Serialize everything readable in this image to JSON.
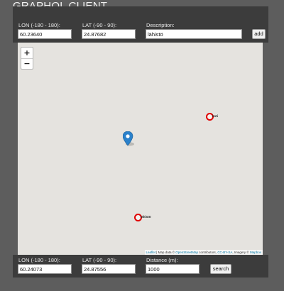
{
  "app": {
    "title": "GRAPHQL CLIENT"
  },
  "top_form": {
    "lon_label": "LON (-180 - 180):",
    "lon_value": "60.23640",
    "lat_label": "LAT (-90 - 90):",
    "lat_value": "24.87682",
    "description_label": "Description:",
    "description_value": "lähistö",
    "add_label": "add"
  },
  "map": {
    "zoom_in": "+",
    "zoom_out": "−",
    "places": [
      {
        "label": "koti"
      },
      {
        "label": "lähistö"
      }
    ],
    "attribution": {
      "leaflet": "Leaflet",
      "map_data": " | Map data © ",
      "osm": "OpenStreetMap",
      "contrib": " contributors, ",
      "license": "CC-BY-SA",
      "imagery": ", Imagery © ",
      "mapbox": "Mapbox"
    },
    "marker_color": "#2a81cb",
    "circle_color": "#e00000"
  },
  "bottom_form": {
    "lon_label": "LON (-180 - 180):",
    "lon_value": "60.24073",
    "lat_label": "LAT (-90 - 90):",
    "lat_value": "24.87556",
    "distance_label": "Distance (m):",
    "distance_value": "1000",
    "search_label": "search"
  }
}
